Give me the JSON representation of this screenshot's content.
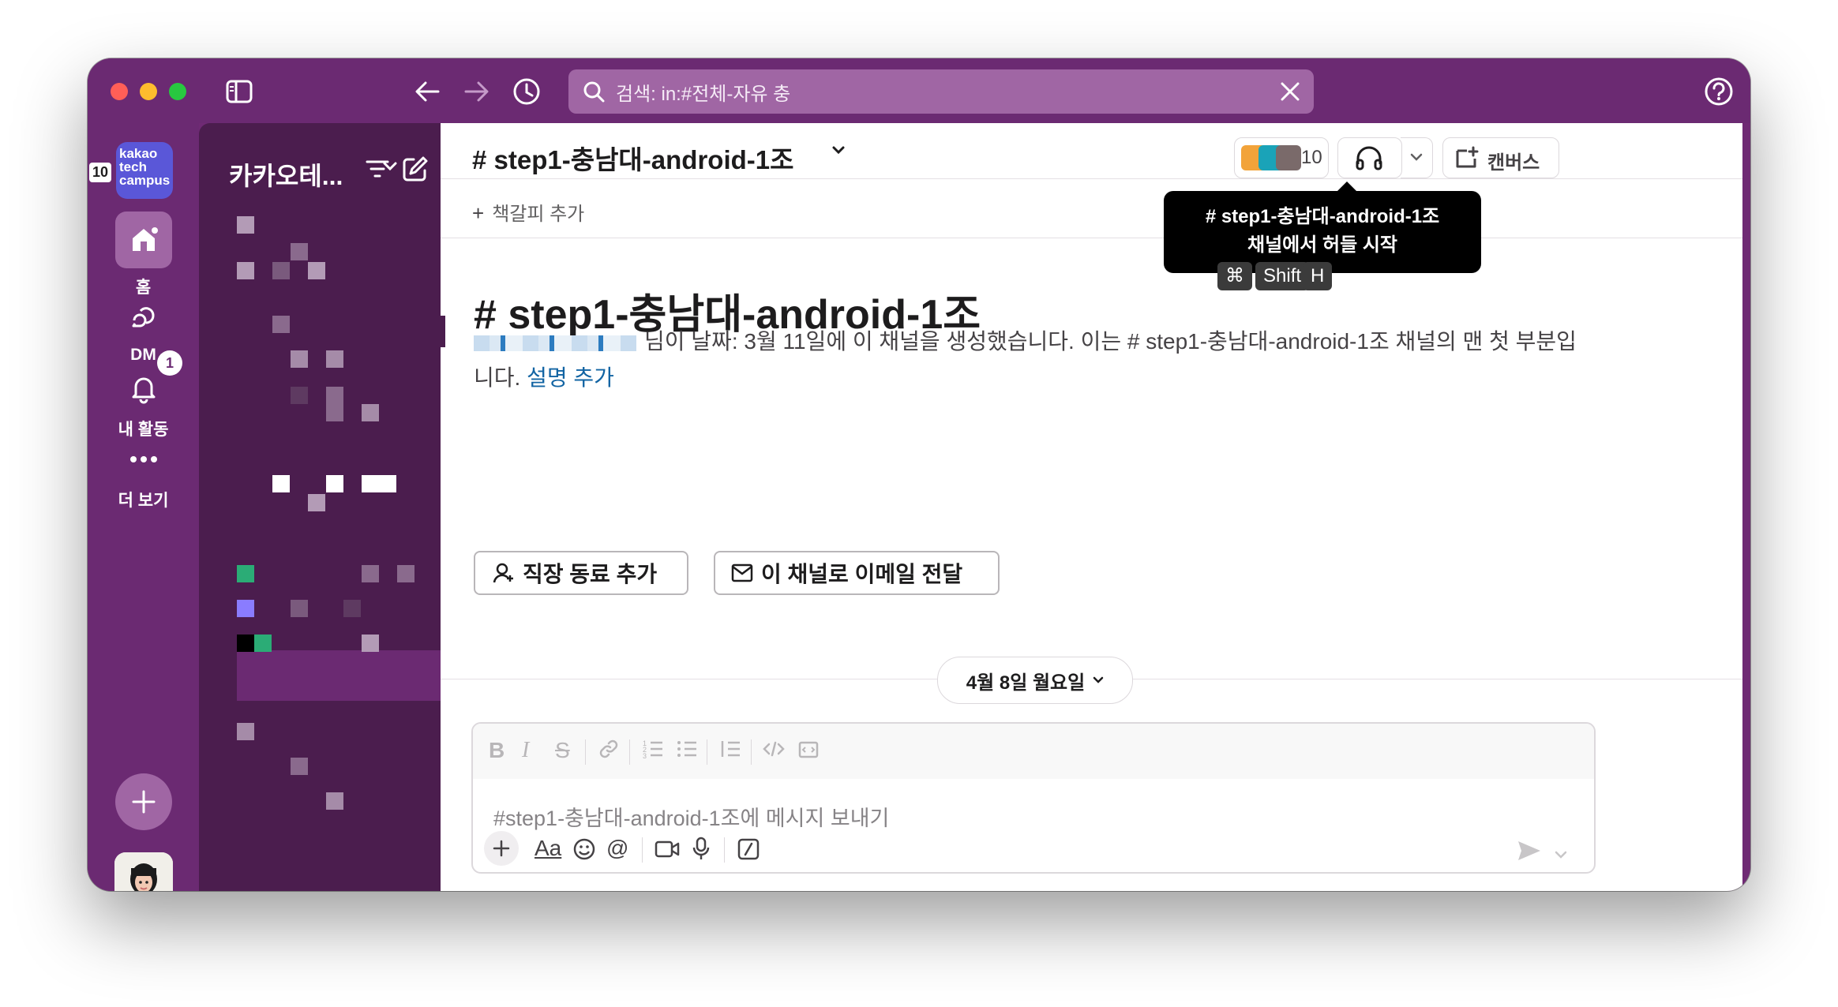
{
  "search": {
    "query": "검색: in:#전체-자유 충"
  },
  "workspace": {
    "logo_text": "kakao tech campus",
    "badge": "10"
  },
  "rail": {
    "home": "홈",
    "dm": "DM",
    "activity": "내 활동",
    "activity_badge": "1",
    "more": "더 보기"
  },
  "sidebar": {
    "workspace_name": "카카오테..."
  },
  "channel": {
    "name": "# step1-충남대-android-1조",
    "member_count": "10",
    "canvas_label": "캔버스",
    "bookmark_label": "책갈피 추가"
  },
  "tooltip": {
    "line1": "# step1-충남대-android-1조",
    "line2": "채널에서 허들 시작",
    "keys": [
      "⌘",
      "Shift",
      "H"
    ]
  },
  "intro": {
    "title": "# step1-충남대-android-1조",
    "text": "님이 날짜: 3월 11일에 이 채널을 생성했습니다. 이는 # step1-충남대-android-1조 채널의 맨 첫 부분입니다.",
    "link": "설명 추가",
    "add_coworker": "직장 동료 추가",
    "email_forward": "이 채널로 이메일 전달"
  },
  "date_divider": "4월 8일 월요일",
  "composer": {
    "placeholder": "#step1-충남대-android-1조에 메시지 보내기"
  },
  "colors": {
    "window": "#6b2a72",
    "sidebar": "#4b1d4e",
    "link": "#1264a3"
  }
}
